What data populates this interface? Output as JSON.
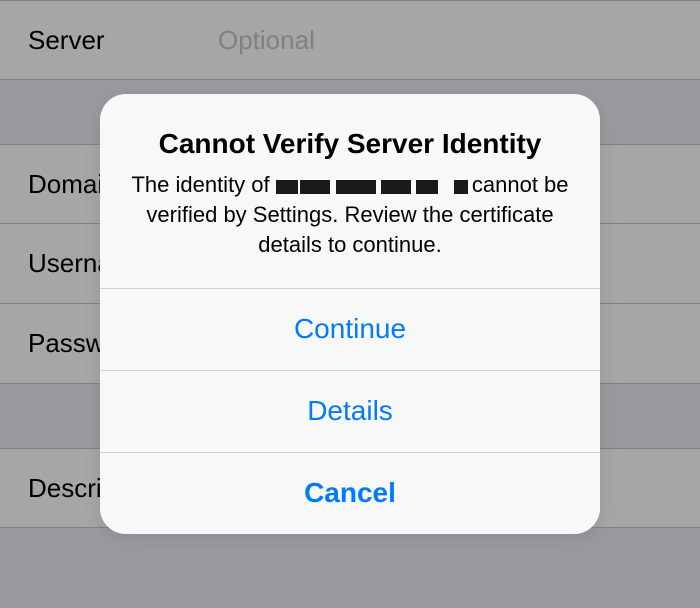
{
  "form": {
    "section1": {
      "server": {
        "label": "Server",
        "placeholder": "Optional"
      }
    },
    "section2": {
      "domain": {
        "label": "Domain"
      },
      "username": {
        "label": "Username"
      },
      "password": {
        "label": "Password"
      }
    },
    "section3": {
      "description": {
        "label": "Description"
      }
    }
  },
  "alert": {
    "title": "Cannot Verify Server Identity",
    "body_prefix": "The identity of ",
    "body_suffix": " cannot be verified by Settings. Review the certificate details to continue.",
    "buttons": {
      "continue": "Continue",
      "details": "Details",
      "cancel": "Cancel"
    }
  }
}
